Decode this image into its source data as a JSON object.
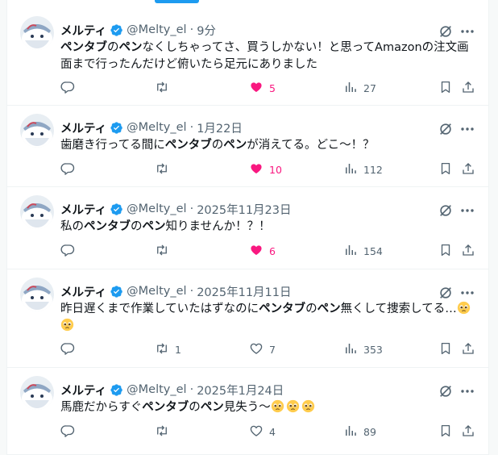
{
  "tweets": [
    {
      "name": "メルティ",
      "handle": "@Melty_el",
      "time": "9分",
      "segments": [
        {
          "t": "ペンタブ",
          "b": true
        },
        {
          "t": "の",
          "b": false
        },
        {
          "t": "ペン",
          "b": true
        },
        {
          "t": "なくしちゃってさ、買うしかない！と思ってAmazonの注文画面まで行ったんだけど俯いたら足元にありました",
          "b": false
        }
      ],
      "emojis": 0,
      "replies": "",
      "retweets": "",
      "likes": "5",
      "liked": true,
      "views": "27"
    },
    {
      "name": "メルティ",
      "handle": "@Melty_el",
      "time": "1月22日",
      "segments": [
        {
          "t": "歯磨き行ってる間に",
          "b": false
        },
        {
          "t": "ペンタブ",
          "b": true
        },
        {
          "t": "の",
          "b": false
        },
        {
          "t": "ペン",
          "b": true
        },
        {
          "t": "が消えてる。どこ～！？",
          "b": false
        }
      ],
      "emojis": 0,
      "replies": "",
      "retweets": "",
      "likes": "10",
      "liked": true,
      "views": "112"
    },
    {
      "name": "メルティ",
      "handle": "@Melty_el",
      "time": "2025年11月23日",
      "segments": [
        {
          "t": "私の",
          "b": false
        },
        {
          "t": "ペンタブ",
          "b": true
        },
        {
          "t": "の",
          "b": false
        },
        {
          "t": "ペン",
          "b": true
        },
        {
          "t": "知りませんか！？！",
          "b": false
        }
      ],
      "emojis": 0,
      "replies": "",
      "retweets": "",
      "likes": "6",
      "liked": true,
      "views": "154"
    },
    {
      "name": "メルティ",
      "handle": "@Melty_el",
      "time": "2025年11月11日",
      "segments": [
        {
          "t": "昨日遅くまで作業していたはずなのに",
          "b": false
        },
        {
          "t": "ペンタブ",
          "b": true
        },
        {
          "t": "の",
          "b": false
        },
        {
          "t": "ペン",
          "b": true
        },
        {
          "t": "無くして捜索してる…",
          "b": false
        }
      ],
      "emojis": 2,
      "emoji_icon": "pleading-face-icon",
      "replies": "",
      "retweets": "1",
      "likes": "7",
      "liked": false,
      "views": "353"
    },
    {
      "name": "メルティ",
      "handle": "@Melty_el",
      "time": "2025年1月24日",
      "segments": [
        {
          "t": "馬鹿だからすぐ",
          "b": false
        },
        {
          "t": "ペンタブ",
          "b": true
        },
        {
          "t": "の",
          "b": false
        },
        {
          "t": "ペン",
          "b": true
        },
        {
          "t": "見失う～",
          "b": false
        }
      ],
      "emojis": 3,
      "emoji_icon": "pleading-face-icon",
      "replies": "",
      "retweets": "",
      "likes": "4",
      "liked": false,
      "views": "89"
    }
  ],
  "colors": {
    "accent": "#1d9bf0",
    "like": "#f91880",
    "secondary": "#536471"
  }
}
